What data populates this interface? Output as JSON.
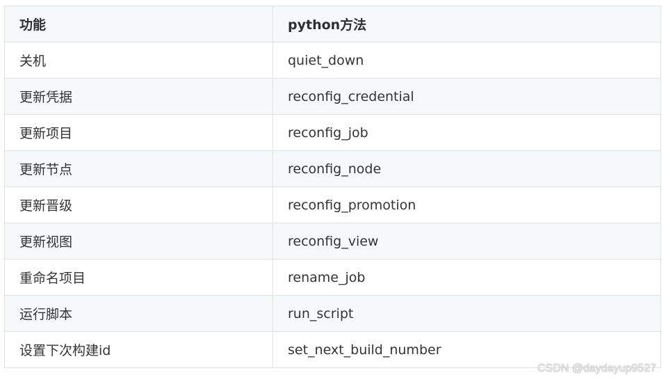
{
  "table": {
    "headers": [
      "功能",
      "python方法"
    ],
    "rows": [
      [
        "关机",
        "quiet_down"
      ],
      [
        "更新凭据",
        "reconfig_credential"
      ],
      [
        "更新项目",
        "reconfig_job"
      ],
      [
        "更新节点",
        "reconfig_node"
      ],
      [
        "更新晋级",
        "reconfig_promotion"
      ],
      [
        "更新视图",
        "reconfig_view"
      ],
      [
        "重命名项目",
        "rename_job"
      ],
      [
        "运行脚本",
        "run_script"
      ],
      [
        "设置下次构建id",
        "set_next_build_number"
      ]
    ]
  },
  "watermark": "CSDN @daydayup9527"
}
